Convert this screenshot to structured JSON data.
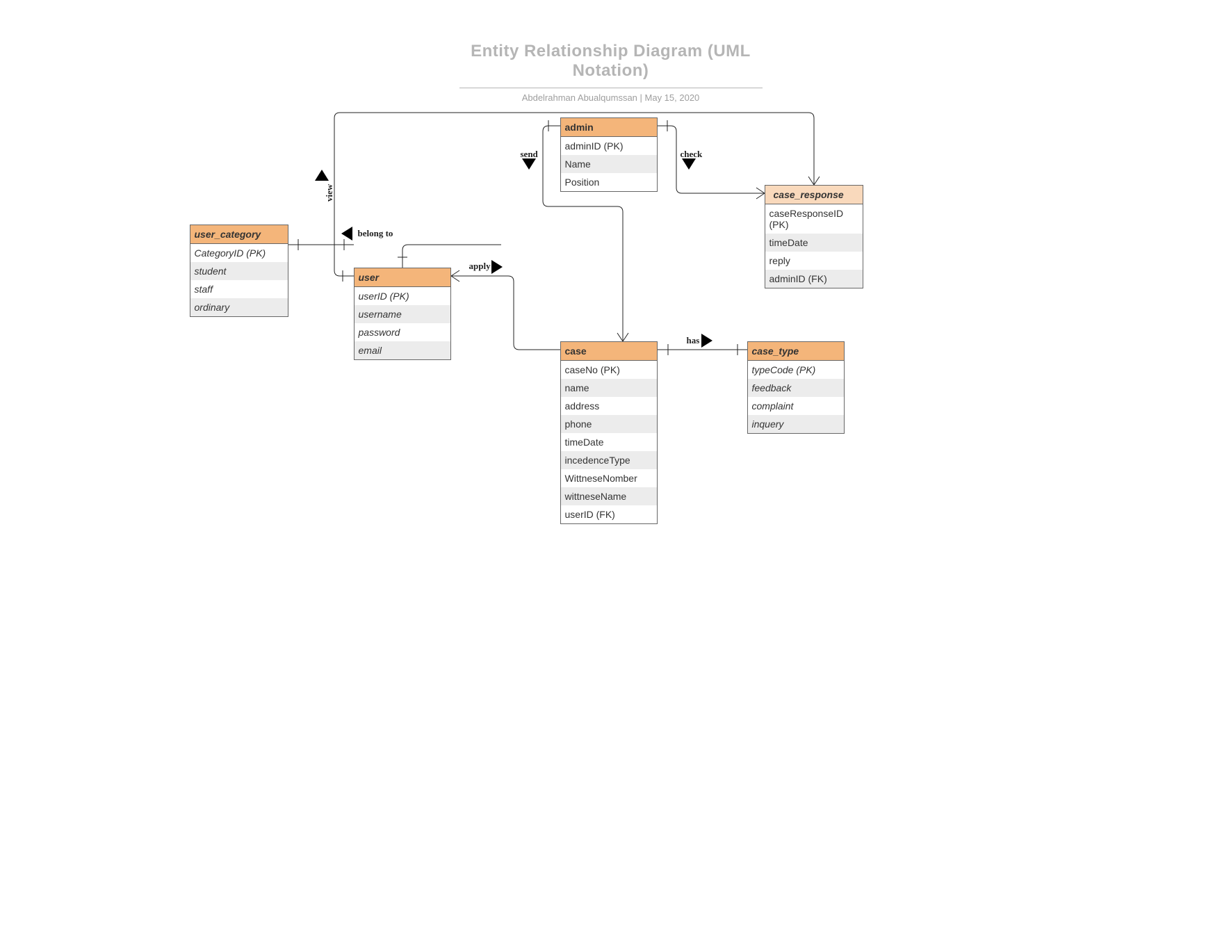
{
  "title": "Entity Relationship Diagram (UML Notation)",
  "subtitle": "Abdelrahman Abualqumssan  |  May 15, 2020",
  "entities": {
    "user_category": {
      "name": "user_category",
      "rows": [
        "CategoryID (PK)",
        "student",
        "staff",
        "ordinary"
      ]
    },
    "user": {
      "name": "user",
      "rows": [
        "userID (PK)",
        "username",
        "password",
        "email"
      ]
    },
    "admin": {
      "name": "admin",
      "rows": [
        "adminID  (PK)",
        "Name",
        "Position"
      ]
    },
    "case": {
      "name": "case",
      "rows": [
        "caseNo  (PK)",
        " name",
        " address",
        " phone",
        "timeDate",
        "incedenceType",
        "WittneseNomber",
        "wittneseName",
        "userID (FK)"
      ]
    },
    "case_type": {
      "name": "case_type",
      "rows": [
        "typeCode (PK)",
        "feedback",
        "complaint",
        "inquery"
      ]
    },
    "case_response": {
      "name": "case_response",
      "rows": [
        "caseResponseID  (PK)",
        "timeDate",
        "reply",
        "adminID (FK)"
      ]
    }
  },
  "rel": {
    "view": "view",
    "belong_to": "belong to",
    "apply": "apply",
    "send": "send",
    "check": "check",
    "has": "has"
  },
  "chart_data": {
    "type": "erd-uml",
    "relationships": [
      {
        "from": "user",
        "to": "user_category",
        "label": "belong to",
        "from_card": "many",
        "to_card": "1"
      },
      {
        "from": "user",
        "to": "case",
        "label": "apply",
        "from_card": "1",
        "to_card": "many"
      },
      {
        "from": "user",
        "to": "case_response",
        "label": "view",
        "from_card": "1",
        "to_card": "many"
      },
      {
        "from": "admin",
        "to": "case",
        "label": "send",
        "from_card": "1",
        "to_card": "many"
      },
      {
        "from": "admin",
        "to": "case_response",
        "label": "check",
        "from_card": "1",
        "to_card": "many"
      },
      {
        "from": "case",
        "to": "case_type",
        "label": "has",
        "from_card": "many",
        "to_card": "1"
      }
    ]
  }
}
